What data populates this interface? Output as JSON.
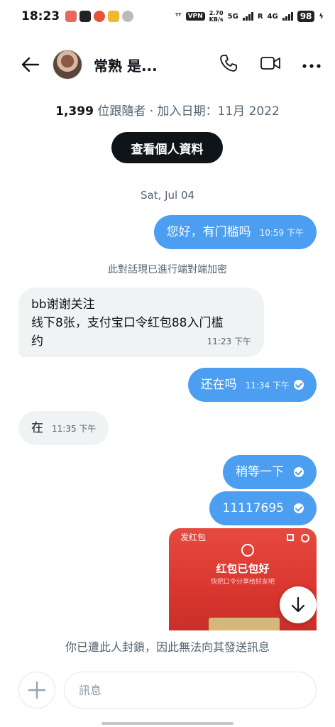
{
  "status_bar": {
    "time": "18:23",
    "vpn": "VPN",
    "speed_value": "2.70",
    "speed_unit": "KB/s",
    "net_5g": "5G",
    "net_4g": "4G",
    "roaming": "R",
    "battery": "98"
  },
  "header": {
    "contact_name": "常熟 是..."
  },
  "profile": {
    "followers_count": "1,399",
    "meta_rest": " 位跟隨者 · 加入日期：11月 2022",
    "view_profile_label": "查看個人資料"
  },
  "conversation": {
    "date_separator": "Sat, Jul 04",
    "encryption_note": "此對話現已進行端對端加密",
    "messages": [
      {
        "direction": "out",
        "text": "您好，有门槛吗",
        "time": "10:59 下午"
      },
      {
        "direction": "in",
        "lines": [
          "bb谢谢关注",
          "线下8张，支付宝口令红包88入门槛",
          "约"
        ],
        "time": "11:23 下午"
      },
      {
        "direction": "out",
        "text": "还在吗",
        "time": "11:34 下午"
      },
      {
        "direction": "in",
        "text": "在",
        "time": "11:35 下午"
      },
      {
        "direction": "out",
        "text": "稍等一下"
      },
      {
        "direction": "out",
        "text": "11117695"
      }
    ],
    "image_message": {
      "title": "发红包",
      "main_text": "红包已包好",
      "sub_text": "快把口令分享给好友吧"
    }
  },
  "footer": {
    "blocked_notice": "你已遭此人封鎖，因此無法向其發送訊息",
    "input_placeholder": "訊息"
  },
  "colors": {
    "outgoing_bubble": "#4b9ef0",
    "incoming_bubble": "#eff3f4",
    "red_packet": "#d9362f"
  }
}
